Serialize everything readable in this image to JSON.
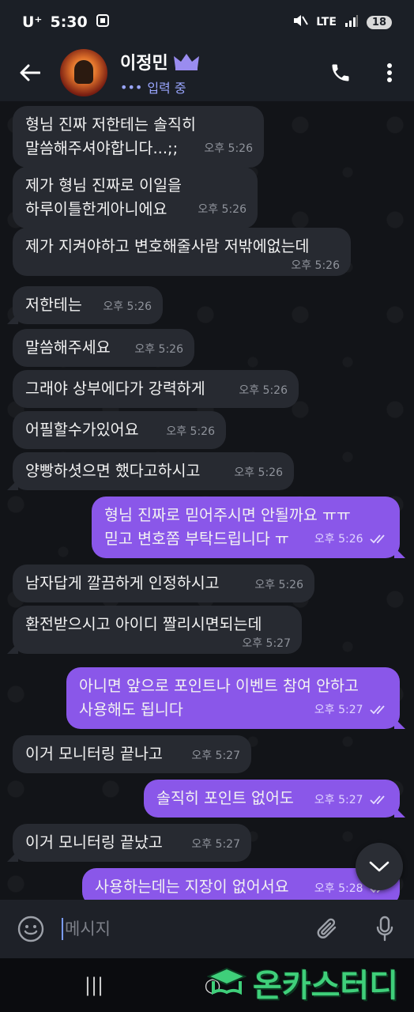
{
  "status_bar": {
    "carrier": "U⁺",
    "time": "5:30",
    "network": "LTE",
    "battery": "18"
  },
  "header": {
    "contact_name": "이정민",
    "status": "입력 중",
    "icons": [
      "back-arrow-icon",
      "crown-icon",
      "phone-icon",
      "more-vert-icon"
    ]
  },
  "messages": [
    {
      "dir": "in",
      "lines": [
        "형님 진짜 저한테는  솔직히",
        "말씀해주셔야합니다...;;"
      ],
      "time": "오후 5:26"
    },
    {
      "dir": "in",
      "lines": [
        "제가 형님 진짜로 이일을",
        "하루이틀한게아니에요"
      ],
      "time": "오후 5:26"
    },
    {
      "dir": "in",
      "lines": [
        "제가 지켜야하고 변호해줄사람 저밖에없는데"
      ],
      "time": "오후 5:26"
    },
    {
      "dir": "in",
      "lines": [
        "저한테는"
      ],
      "time": "오후 5:26"
    },
    {
      "dir": "in",
      "lines": [
        "말씀해주세요"
      ],
      "time": "오후 5:26"
    },
    {
      "dir": "in",
      "lines": [
        "그래야 상부에다가 강력하게"
      ],
      "time": "오후 5:26"
    },
    {
      "dir": "in",
      "lines": [
        "어필할수가있어요"
      ],
      "time": "오후 5:26"
    },
    {
      "dir": "in",
      "lines": [
        "양빵하셧으면 했다고하시고"
      ],
      "time": "오후 5:26"
    },
    {
      "dir": "out",
      "lines": [
        "형님 진짜로 믿어주시면 안될까요 ㅠㅠ",
        "믿고 변호쫌 부탁드립니다 ㅠ"
      ],
      "time": "오후 5:26"
    },
    {
      "dir": "in",
      "lines": [
        "남자답게 깔끔하게 인정하시고"
      ],
      "time": "오후 5:26"
    },
    {
      "dir": "in",
      "lines": [
        "환전받으시고  아이디 짤리시면되는데"
      ],
      "time": "오후 5:27"
    },
    {
      "dir": "out",
      "lines": [
        "아니면 앞으로 포인트나 이벤트 참여 안하고",
        "사용해도 됩니다"
      ],
      "time": "오후 5:27"
    },
    {
      "dir": "in",
      "lines": [
        "이거 모니터링 끝나고"
      ],
      "time": "오후 5:27"
    },
    {
      "dir": "out",
      "lines": [
        "솔직히 포인트 없어도"
      ],
      "time": "오후 5:27"
    },
    {
      "dir": "in",
      "lines": [
        "이거 모니터링 끝났고"
      ],
      "time": "오후 5:27"
    },
    {
      "dir": "out",
      "lines": [
        "사용하는데는 지장이 없어서요"
      ],
      "time": "오후 5:28"
    }
  ],
  "input": {
    "placeholder": "메시지",
    "icons": [
      "emoji-icon",
      "attach-icon",
      "mic-icon"
    ]
  },
  "navigation": {
    "recent_apps": "|||",
    "home": "○"
  },
  "watermark": "온카스터디",
  "colors": {
    "outgoing_bubble": "#8a57e9",
    "incoming_bubble": "#272a31",
    "accent": "#9aa6ff"
  }
}
